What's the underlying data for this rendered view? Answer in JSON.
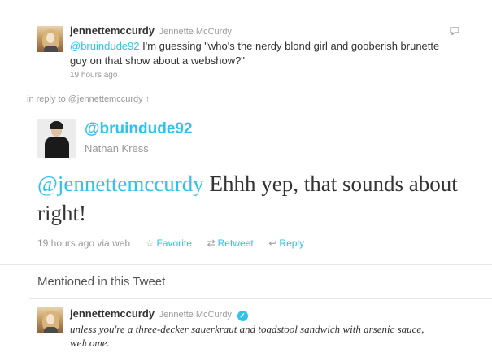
{
  "top_tweet": {
    "screen_name": "jennettemccurdy",
    "full_name": "Jennette McCurdy",
    "mention": "@bruindude92",
    "text": " I'm guessing \"who's the nerdy blond girl and gooberish brunette guy on that show about a webshow?\"",
    "time": "19 hours ago"
  },
  "in_reply_to": "in reply to @jennettemccurdy ↑",
  "main_tweet": {
    "handle": "@bruindude92",
    "full_name": "Nathan Kress",
    "mention": "@jennettemccurdy",
    "text": " Ehhh yep, that sounds about right!",
    "time_via": "19 hours ago via web",
    "actions": {
      "favorite": "Favorite",
      "retweet": "Retweet",
      "reply": "Reply"
    }
  },
  "mentioned": {
    "title": "Mentioned in this Tweet",
    "screen_name": "jennettemccurdy",
    "full_name": "Jennette McCurdy",
    "bio": "unless you're a three-decker sauerkraut and toadstool sandwich with arsenic sauce, welcome."
  },
  "icons": {
    "reply_outline": "speech-bubble-icon",
    "favorite": "star-icon",
    "retweet": "retweet-icon",
    "reply": "reply-arrow-icon",
    "verified": "verified-badge-icon"
  },
  "colors": {
    "link": "#2fc2ef",
    "muted": "#999999",
    "text": "#333333"
  }
}
